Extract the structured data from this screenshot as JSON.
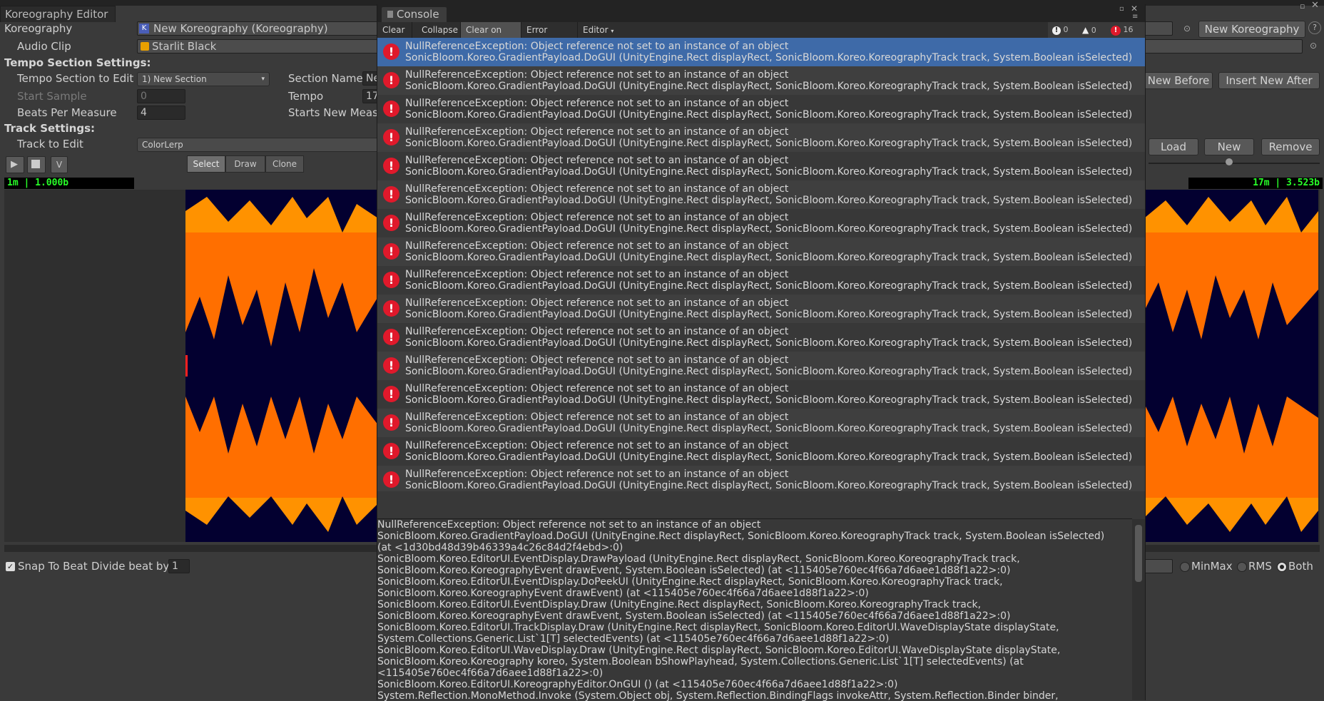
{
  "editor": {
    "tab_title": "Koreography Editor",
    "koreography_label": "Koreography",
    "koreography_value": "New Koreography (Koreography)",
    "audio_clip_label": "Audio Clip",
    "audio_clip_value": "Starlit Black",
    "new_koreo_button": "New Koreography",
    "tempo_header": "Tempo Section Settings:",
    "tempo_section_label": "Tempo Section to Edit",
    "tempo_section_value": "1) New Section",
    "section_name_label": "Section Name",
    "section_name_value": "Ne",
    "insert_before": "New Before",
    "insert_after": "Insert New After",
    "start_sample_label": "Start Sample",
    "start_sample_value": "0",
    "tempo_label": "Tempo",
    "tempo_value": "17",
    "beats_label": "Beats Per Measure",
    "beats_value": "4",
    "starts_new_label": "Starts New Measu",
    "track_header": "Track Settings:",
    "track_label": "Track to Edit",
    "track_value": "ColorLerp",
    "load_button": "Load",
    "new_button": "New",
    "remove_button": "Remove",
    "mode_select": "Select",
    "mode_draw": "Draw",
    "mode_clone": "Clone",
    "v_button": "V",
    "counter_left": "1m | 1.000b",
    "counter_right": "17m | 3.523b",
    "snap_label": "Snap To Beat",
    "divide_label": "Divide beat by",
    "divide_value": "1",
    "radio_minmax": "MinMax",
    "radio_rms": "RMS",
    "radio_both": "Both"
  },
  "console": {
    "tab_title": "Console",
    "toolbar": {
      "clear": "Clear",
      "collapse": "Collapse",
      "clear_on_play": "Clear on Play",
      "error_pause": "Error Pause",
      "editor": "Editor"
    },
    "counts": {
      "logs": "0",
      "warnings": "0",
      "errors": "16"
    },
    "entry_line1": "NullReferenceException: Object reference not set to an instance of an object",
    "entry_line2": "SonicBloom.Koreo.GradientPayload.DoGUI (UnityEngine.Rect displayRect, SonicBloom.Koreo.KoreographyTrack track, System.Boolean isSelected)",
    "entry_count": 16,
    "detail_lines": [
      "NullReferenceException: Object reference not set to an instance of an object",
      "SonicBloom.Koreo.GradientPayload.DoGUI (UnityEngine.Rect displayRect, SonicBloom.Koreo.KoreographyTrack track, System.Boolean isSelected)",
      "(at <1d30bd48d39b46339a4c26c84d2f4ebd>:0)",
      "SonicBloom.Koreo.EditorUI.EventDisplay.DrawPayload (UnityEngine.Rect displayRect, SonicBloom.Koreo.KoreographyTrack track,",
      "SonicBloom.Koreo.KoreographyEvent drawEvent, System.Boolean isSelected) (at <115405e760ec4f66a7d6aee1d88f1a22>:0)",
      "SonicBloom.Koreo.EditorUI.EventDisplay.DoPeekUI (UnityEngine.Rect displayRect, SonicBloom.Koreo.KoreographyTrack track,",
      "SonicBloom.Koreo.KoreographyEvent drawEvent) (at <115405e760ec4f66a7d6aee1d88f1a22>:0)",
      "SonicBloom.Koreo.EditorUI.EventDisplay.Draw (UnityEngine.Rect displayRect, SonicBloom.Koreo.KoreographyTrack track,",
      "SonicBloom.Koreo.KoreographyEvent drawEvent, System.Boolean isSelected) (at <115405e760ec4f66a7d6aee1d88f1a22>:0)",
      "SonicBloom.Koreo.EditorUI.TrackDisplay.Draw (UnityEngine.Rect displayRect, SonicBloom.Koreo.EditorUI.WaveDisplayState displayState,",
      "System.Collections.Generic.List`1[T] selectedEvents) (at <115405e760ec4f66a7d6aee1d88f1a22>:0)",
      "SonicBloom.Koreo.EditorUI.WaveDisplay.Draw (UnityEngine.Rect displayRect, SonicBloom.Koreo.EditorUI.WaveDisplayState displayState,",
      "SonicBloom.Koreo.Koreography koreo, System.Boolean bShowPlayhead, System.Collections.Generic.List`1[T] selectedEvents) (at",
      "<115405e760ec4f66a7d6aee1d88f1a22>:0)",
      "SonicBloom.Koreo.EditorUI.KoreographyEditor.OnGUI () (at <115405e760ec4f66a7d6aee1d88f1a22>:0)",
      "System.Reflection.MonoMethod.Invoke (System.Object obj, System.Reflection.BindingFlags invokeAttr, System.Reflection.Binder binder,"
    ]
  },
  "colors": {
    "wave_light": "#ff9200",
    "wave_mid": "#ff6f00",
    "wave_dark": "#030030",
    "error_red": "#e0192b",
    "selected_row": "#3e6aa8"
  },
  "icons": [
    "console-icon",
    "error-icon",
    "warning-icon",
    "info-icon",
    "play-icon",
    "stop-icon",
    "radio-icon",
    "checkbox-icon"
  ]
}
